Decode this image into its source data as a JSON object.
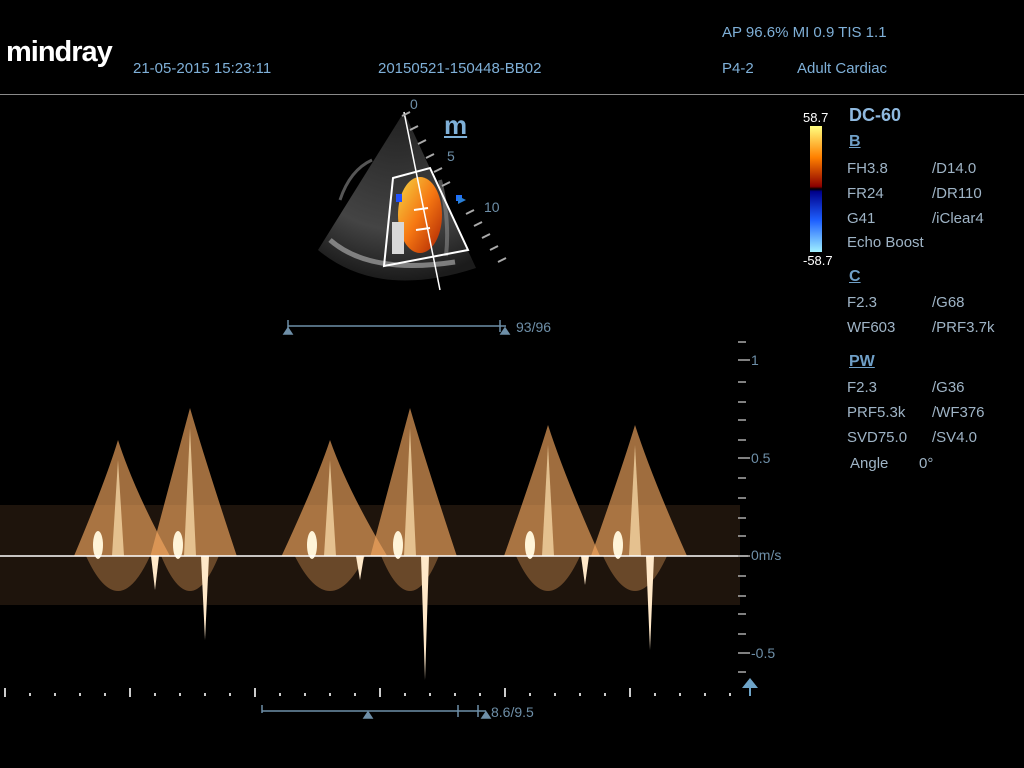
{
  "brand": "mindray",
  "header": {
    "datetime": "21-05-2015 15:23:11",
    "patient_id": "20150521-150448-BB02",
    "ap_mi_tis": "AP 96.6%  MI 0.9 TIS 1.1",
    "probe": "P4-2",
    "exam": "Adult Cardiac"
  },
  "color_scale": {
    "max": "58.7",
    "min": "-58.7"
  },
  "sidebar": {
    "preset": "DC-60",
    "b": {
      "title": "B",
      "rows": [
        [
          "FH3.8",
          "/D14.0"
        ],
        [
          "FR24",
          "/DR110"
        ],
        [
          "G41",
          "/iClear4"
        ]
      ],
      "extra": "Echo Boost"
    },
    "c": {
      "title": "C",
      "rows": [
        [
          "F2.3",
          "/G68"
        ],
        [
          "WF603",
          "/PRF3.7k"
        ]
      ]
    },
    "pw": {
      "title": "PW",
      "rows": [
        [
          "F2.3",
          "/G36"
        ],
        [
          "PRF5.3k",
          "/WF376"
        ],
        [
          "SVD75.0",
          "/SV4.0"
        ]
      ],
      "angle_label": "Angle",
      "angle_value": "0°"
    }
  },
  "image_view": {
    "depth_ticks": [
      "0",
      "5",
      "10"
    ],
    "marker": "m",
    "cine_counter": "93/96"
  },
  "spectrum": {
    "scale_labels": [
      "1",
      "0.5",
      "0m/s",
      "-0.5"
    ],
    "sweep_counter": "8.6/9.5"
  },
  "colors": {
    "doppler": "#f5a860",
    "accent": "#7fb0d8"
  }
}
